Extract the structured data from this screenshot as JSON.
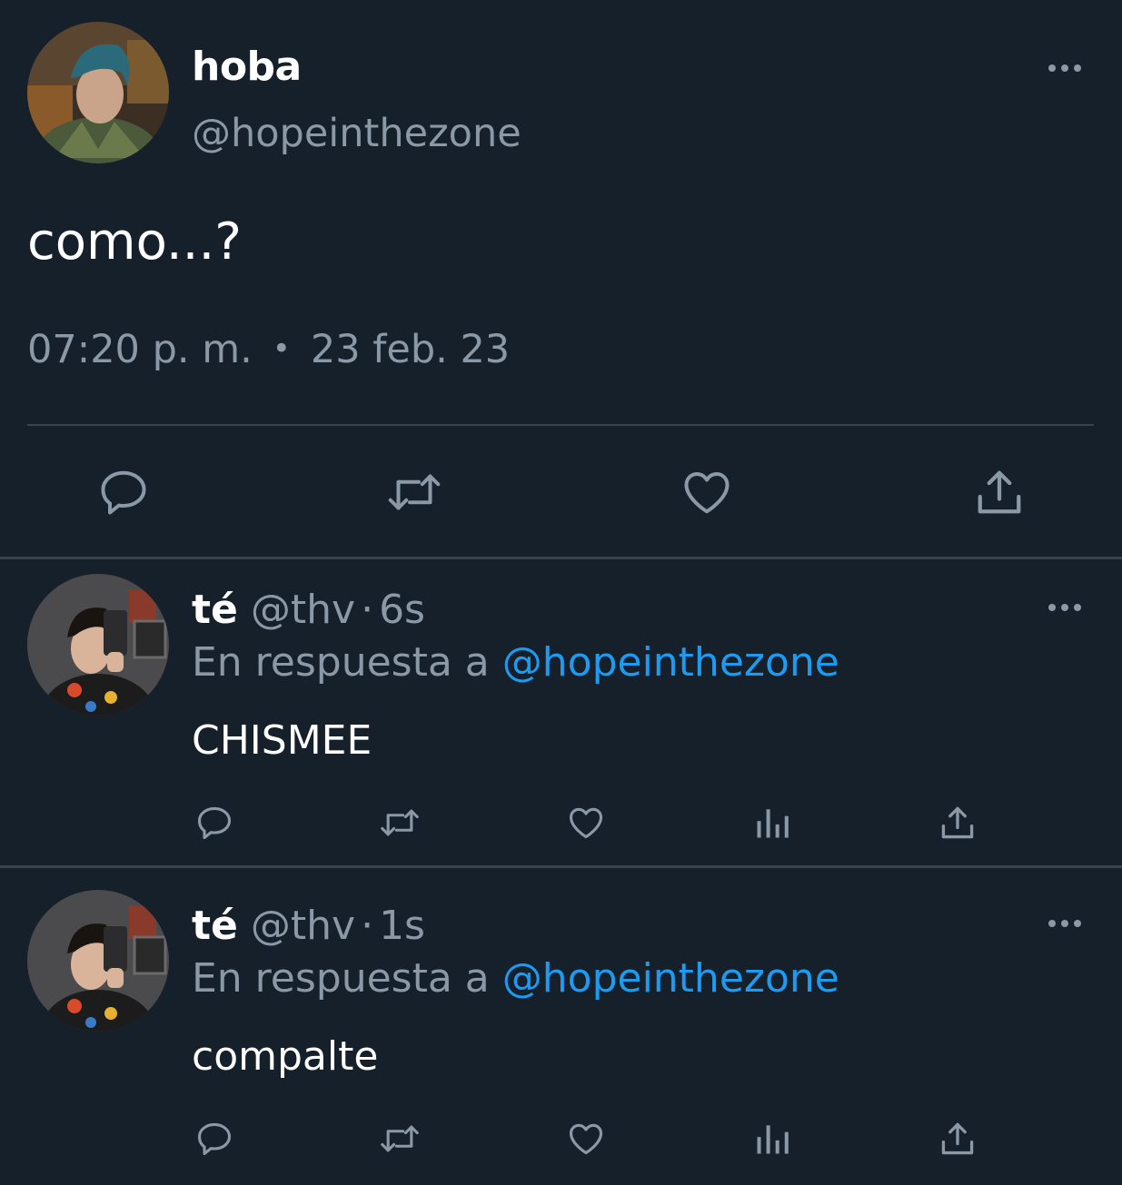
{
  "main_tweet": {
    "display_name": "hoba",
    "handle": "@hopeinthezone",
    "text": "como...?",
    "time": "07:20 p. m.",
    "separator": "•",
    "date": "23 feb. 23"
  },
  "replies": [
    {
      "display_name": "té",
      "handle": "@thv",
      "separator": "·",
      "age": "6s",
      "reply_prefix": "En respuesta a",
      "reply_mention": "@hopeinthezone",
      "text": "CHISMEE"
    },
    {
      "display_name": "té",
      "handle": "@thv",
      "separator": "·",
      "age": "1s",
      "reply_prefix": "En respuesta a",
      "reply_mention": "@hopeinthezone",
      "text": "compalte"
    }
  ],
  "colors": {
    "background": "#15202b",
    "secondary_text": "#8b98a5",
    "link": "#1d9bf0",
    "divider": "#38444d"
  },
  "icons": [
    "reply-icon",
    "retweet-icon",
    "like-icon",
    "views-icon",
    "share-icon",
    "more-icon"
  ]
}
